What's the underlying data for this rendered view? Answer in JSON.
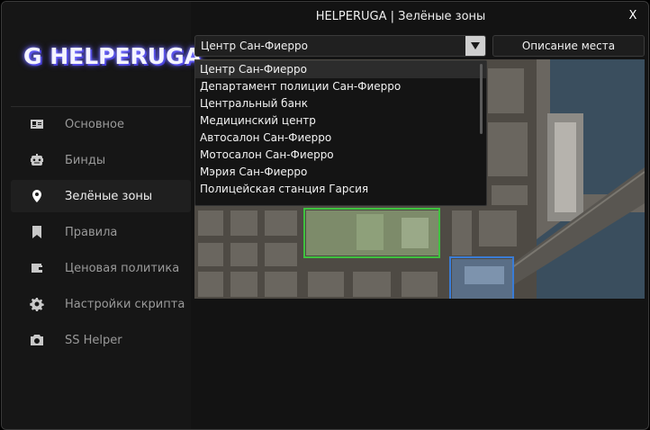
{
  "window": {
    "title": "HELPERUGA | Зелёные зоны",
    "close_label": "X"
  },
  "logo": {
    "text": "G HELPERUGA"
  },
  "sidebar": {
    "items": [
      {
        "label": "Основное",
        "icon": "id-card-icon"
      },
      {
        "label": "Бинды",
        "icon": "robot-icon"
      },
      {
        "label": "Зелёные зоны",
        "icon": "map-pin-icon",
        "active": true
      },
      {
        "label": "Правила",
        "icon": "bookmark-icon"
      },
      {
        "label": "Ценовая политика",
        "icon": "wallet-icon"
      },
      {
        "label": "Настройки скрипта",
        "icon": "gear-icon"
      },
      {
        "label": "SS Helper",
        "icon": "camera-icon"
      }
    ]
  },
  "zone_select": {
    "value": "Центр Сан-Фиерро",
    "options": [
      "Центр Сан-Фиерро",
      "Департамент полиции Сан-Фиерро",
      "Центральный банк",
      "Медицинский центр",
      "Автосалон Сан-Фиерро",
      "Мотосалон Сан-Фиерро",
      "Мэрия Сан-Фиерро",
      "Полицейская станция Гарсия"
    ]
  },
  "description_button": {
    "label": "Описание места"
  },
  "colors": {
    "accent_zone_green": "#3fc23f",
    "zone_blue": "#3a7cd6",
    "water": "#3a4e5e",
    "logo_glow": "#5b54ff"
  }
}
